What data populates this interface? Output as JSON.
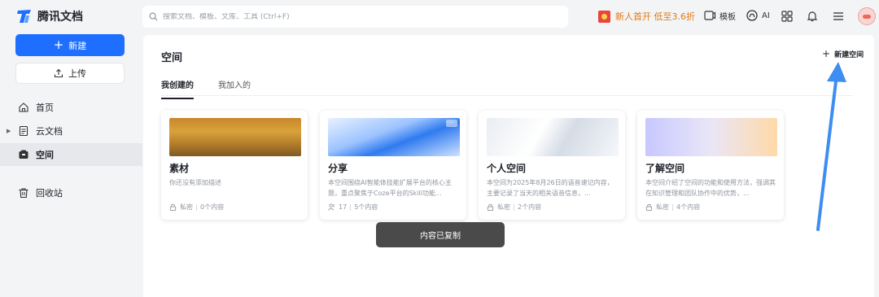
{
  "app": {
    "title": "腾讯文档"
  },
  "search": {
    "placeholder": "搜索文档、模板、文库、工具 (Ctrl+F)"
  },
  "header": {
    "promo": "新人首开 低至3.6折",
    "template_label": "模板",
    "ai_label": "AI"
  },
  "sidebar": {
    "new_label": "新建",
    "upload_label": "上传",
    "items": [
      {
        "label": "首页",
        "icon": "home-icon"
      },
      {
        "label": "云文档",
        "icon": "document-icon"
      },
      {
        "label": "空间",
        "icon": "space-icon"
      },
      {
        "label": "回收站",
        "icon": "trash-icon"
      }
    ]
  },
  "main": {
    "title": "空间",
    "new_space_label": "新建空间",
    "tabs": [
      {
        "label": "我创建的"
      },
      {
        "label": "我加入的"
      }
    ],
    "cards": [
      {
        "title": "素材",
        "desc": "你还没有添加描述",
        "privacy": "私密",
        "count": "0个内容",
        "image": "forest"
      },
      {
        "title": "分享",
        "desc": "本空间围绕AI智能体技能扩展平台的核心主题，重点聚焦于Coze平台的Skill功能...",
        "members": "17",
        "count": "5个内容",
        "image": "blue-waves"
      },
      {
        "title": "个人空间",
        "desc": "本空间为2025年8月26日的语音速记内容，主要记录了当天的相关语音信息，...",
        "privacy": "私密",
        "count": "2个内容",
        "image": "white-waves"
      },
      {
        "title": "了解空间",
        "desc": "本空间介绍了空间的功能和使用方法，强调其在知识管理和团队协作中的优势，...",
        "privacy": "私密",
        "count": "4个内容",
        "image": "pastel-gradient"
      }
    ]
  },
  "toast": {
    "text": "内容已复制"
  },
  "colors": {
    "accent": "#1e6fff",
    "promo": "#e07a16",
    "annotation": "#3d8ef0"
  }
}
